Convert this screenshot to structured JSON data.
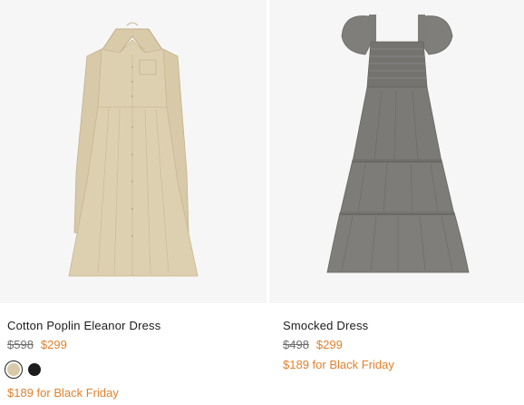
{
  "products": [
    {
      "name": "Cotton Poplin Eleanor Dress",
      "was_price": "$598",
      "sale_price": "$299",
      "promo": "$189 for Black Friday",
      "swatch_colors": [
        "#d8c9a8",
        "#1c1c1c"
      ],
      "dress_color": "#ddd0b0"
    },
    {
      "name": "Smocked Dress",
      "was_price": "$498",
      "sale_price": "$299",
      "promo": "$189 for Black Friday",
      "dress_color": "#7a7876"
    }
  ],
  "colors": {
    "sale": "#e0812d",
    "image_bg": "#f6f6f6"
  }
}
